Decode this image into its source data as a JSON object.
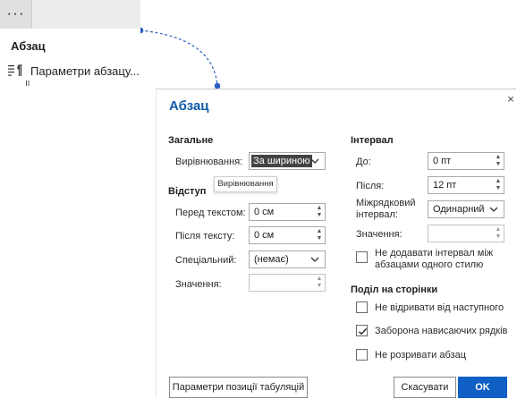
{
  "toolbar": {
    "more_label": "···"
  },
  "menu": {
    "title": "Абзац",
    "item_label": "Параметри абзацу..."
  },
  "dialog": {
    "title": "Абзац",
    "close_label": "×",
    "general": {
      "heading": "Загальне",
      "alignment_label": "Вирівнювання:",
      "alignment_value": "За шириною",
      "tooltip": "Вирівнювання"
    },
    "indent": {
      "heading": "Відступ",
      "before_label": "Перед текстом:",
      "before_value": "0 см",
      "after_label": "Після тексту:",
      "after_value": "0 см",
      "special_label": "Спеціальний:",
      "special_value": "(немає)",
      "by_label": "Значення:",
      "by_value": ""
    },
    "spacing": {
      "heading": "Інтервал",
      "before_label": "До:",
      "before_value": "0 пт",
      "after_label": "Після:",
      "after_value": "12 пт",
      "line_label_1": "Міжрядковий",
      "line_label_2": "інтервал:",
      "line_value": "Одинарний",
      "at_label": "Значення:",
      "at_value": "",
      "no_space_label_1": "Не додавати інтервал між",
      "no_space_label_2": "абзацами одного стилю",
      "no_space_checked": false
    },
    "pagination": {
      "heading": "Поділ на сторінки",
      "keep_next_label": "Не відривати від наступного",
      "keep_next_checked": false,
      "widow_label": "Заборона нависаючих рядків",
      "widow_checked": true,
      "keep_lines_label": "Не розривати абзац",
      "keep_lines_checked": false
    },
    "buttons": {
      "tabs": "Параметри позиції табуляцій",
      "cancel": "Скасувати",
      "ok": "OK"
    }
  },
  "colors": {
    "accent": "#0f5fc4",
    "title": "#0e5aa8",
    "connector": "#2a5fc0"
  },
  "icons": {
    "menu_item_icon": "paragraph-settings-icon",
    "more_icon": "more-horizontal-icon",
    "close_icon": "close-icon",
    "dropdown_icon": "chevron-down-icon",
    "spin_icon": "spin-up-down-icon",
    "check_icon": "checkmark-icon"
  }
}
